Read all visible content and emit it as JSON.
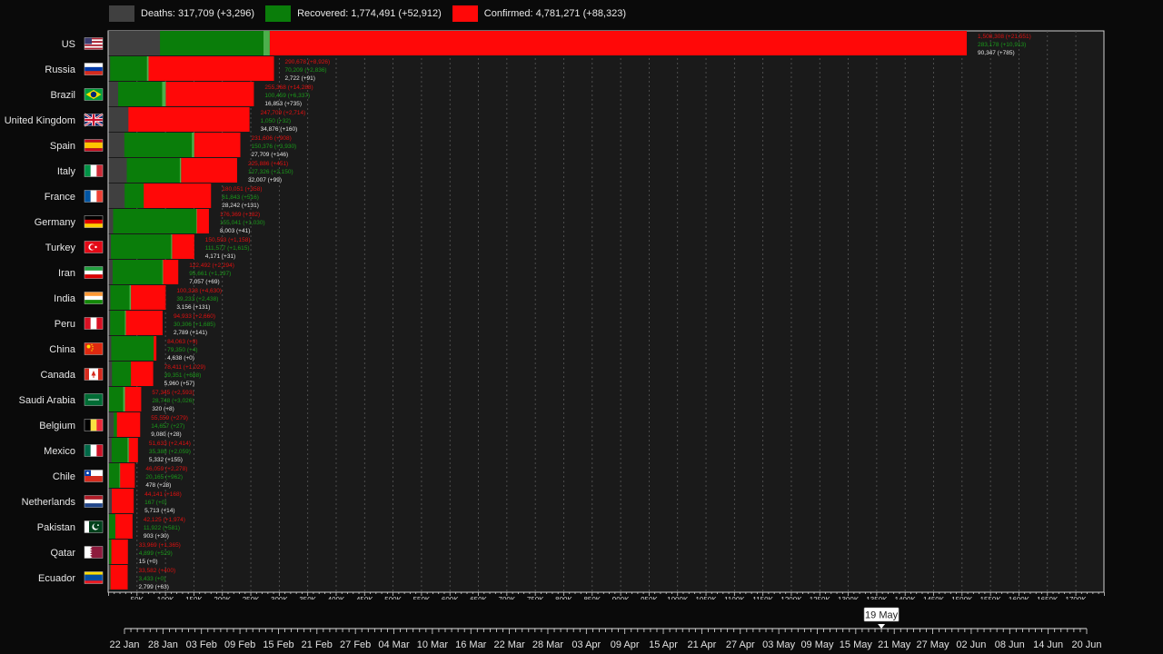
{
  "legend": {
    "deaths": "Deaths: 317,709 (+3,296)",
    "recovered": "Recovered: 1,774,491 (+52,912)",
    "confirmed": "Confirmed: 4,781,271 (+88,323)"
  },
  "colors": {
    "deaths": "#404040",
    "recovered": "#0a7d0a",
    "confirmed": "#ff0808",
    "confirmed_new": "#ff5c5c",
    "recovered_new": "#4caf4c",
    "background": "#0a0a0a",
    "plot_bg": "#1a1a1a"
  },
  "chart_data": {
    "type": "bar",
    "orientation": "horizontal",
    "stacking": "overlay",
    "grid": true,
    "xlim": [
      0,
      1750000
    ],
    "xticks": [
      "50K",
      "100K",
      "150K",
      "200K",
      "250K",
      "300K",
      "350K",
      "400K",
      "450K",
      "500K",
      "550K",
      "600K",
      "650K",
      "700K",
      "750K",
      "800K",
      "850K",
      "900K",
      "950K",
      "1000K",
      "1050K",
      "1100K",
      "1150K",
      "1200K",
      "1250K",
      "1300K",
      "1350K",
      "1400K",
      "1450K",
      "1500K",
      "1550K",
      "1600K",
      "1650K",
      "1700K"
    ],
    "categories": [
      "US",
      "Russia",
      "Brazil",
      "United Kingdom",
      "Spain",
      "Italy",
      "France",
      "Germany",
      "Turkey",
      "Iran",
      "India",
      "Peru",
      "China",
      "Canada",
      "Saudi Arabia",
      "Belgium",
      "Mexico",
      "Chile",
      "Netherlands",
      "Pakistan",
      "Qatar",
      "Ecuador"
    ],
    "series": [
      {
        "name": "Confirmed",
        "values": [
          1508308,
          290678,
          255368,
          247709,
          231606,
          225886,
          180051,
          176369,
          150593,
          122492,
          100328,
          94933,
          84063,
          78411,
          57345,
          55559,
          51633,
          46059,
          44141,
          42125,
          33969,
          33582
        ]
      },
      {
        "name": "Recovered",
        "values": [
          283178,
          70209,
          100459,
          1050,
          150376,
          127326,
          61843,
          155041,
          111577,
          95661,
          39233,
          30306,
          79350,
          39351,
          28748,
          14657,
          35388,
          20165,
          167,
          11922,
          4899,
          3433
        ]
      },
      {
        "name": "Deaths",
        "values": [
          90347,
          2722,
          16853,
          34876,
          27709,
          32007,
          28242,
          8003,
          4171,
          7057,
          3156,
          2789,
          4638,
          5960,
          320,
          9080,
          5332,
          478,
          5713,
          903,
          15,
          2799
        ]
      }
    ],
    "labels": [
      {
        "country": "US",
        "confirmed": "1,508,308 (+21,551)",
        "recovered": "283,178 (+10,913)",
        "deaths": "90,347 (+785)"
      },
      {
        "country": "Russia",
        "confirmed": "290,678 (+8,926)",
        "recovered": "70,209 (+2,836)",
        "deaths": "2,722 (+91)"
      },
      {
        "country": "Brazil",
        "confirmed": "255,368 (+14,288)",
        "recovered": "100,459 (+6,337)",
        "deaths": "16,853 (+735)"
      },
      {
        "country": "United Kingdom",
        "confirmed": "247,709 (+2,714)",
        "recovered": "1,050 (+32)",
        "deaths": "34,876 (+160)"
      },
      {
        "country": "Spain",
        "confirmed": "231,606 (+908)",
        "recovered": "150,376 (+3,930)",
        "deaths": "27,709 (+146)"
      },
      {
        "country": "Italy",
        "confirmed": "225,886 (+451)",
        "recovered": "127,326 (+2,150)",
        "deaths": "32,007 (+99)"
      },
      {
        "country": "France",
        "confirmed": "180,051 (+358)",
        "recovered": "61,843 (+516)",
        "deaths": "28,242 (+131)"
      },
      {
        "country": "Germany",
        "confirmed": "176,369 (+182)",
        "recovered": "155,041 (+1,030)",
        "deaths": "8,003 (+41)"
      },
      {
        "country": "Turkey",
        "confirmed": "150,593 (+1,158)",
        "recovered": "111,577 (+1,615)",
        "deaths": "4,171 (+31)"
      },
      {
        "country": "Iran",
        "confirmed": "122,492 (+2,294)",
        "recovered": "95,661 (+1,197)",
        "deaths": "7,057 (+69)"
      },
      {
        "country": "India",
        "confirmed": "100,328 (+4,630)",
        "recovered": "39,233 (+2,438)",
        "deaths": "3,156 (+131)"
      },
      {
        "country": "Peru",
        "confirmed": "94,933 (+2,660)",
        "recovered": "30,306 (+1,685)",
        "deaths": "2,789 (+141)"
      },
      {
        "country": "China",
        "confirmed": "84,063 (+9)",
        "recovered": "79,350 (+4)",
        "deaths": "4,638 (+0)"
      },
      {
        "country": "Canada",
        "confirmed": "78,411 (+1,029)",
        "recovered": "39,351 (+688)",
        "deaths": "5,960 (+57)"
      },
      {
        "country": "Saudi Arabia",
        "confirmed": "57,345 (+2,593)",
        "recovered": "28,748 (+3,026)",
        "deaths": "320 (+8)"
      },
      {
        "country": "Belgium",
        "confirmed": "55,559 (+279)",
        "recovered": "14,657 (+27)",
        "deaths": "9,080 (+28)"
      },
      {
        "country": "Mexico",
        "confirmed": "51,633 (+2,414)",
        "recovered": "35,388 (+2,059)",
        "deaths": "5,332 (+155)"
      },
      {
        "country": "Chile",
        "confirmed": "46,059 (+2,278)",
        "recovered": "20,165 (+962)",
        "deaths": "478 (+28)"
      },
      {
        "country": "Netherlands",
        "confirmed": "44,141 (+168)",
        "recovered": "167 (+0)",
        "deaths": "5,713 (+14)"
      },
      {
        "country": "Pakistan",
        "confirmed": "42,125 (+1,974)",
        "recovered": "11,922 (+581)",
        "deaths": "903 (+30)"
      },
      {
        "country": "Qatar",
        "confirmed": "33,969 (+1,365)",
        "recovered": "4,899 (+529)",
        "deaths": "15 (+0)"
      },
      {
        "country": "Ecuador",
        "confirmed": "33,582 (+400)",
        "recovered": "3,433 (+0)",
        "deaths": "2,799 (+63)"
      }
    ]
  },
  "timeline": {
    "dates": [
      "22 Jan",
      "28 Jan",
      "03 Feb",
      "09 Feb",
      "15 Feb",
      "21 Feb",
      "27 Feb",
      "04 Mar",
      "10 Mar",
      "16 Mar",
      "22 Mar",
      "28 Mar",
      "03 Apr",
      "09 Apr",
      "15 Apr",
      "21 Apr",
      "27 Apr",
      "03 May",
      "09 May",
      "15 May",
      "21 May",
      "27 May",
      "02 Jun",
      "08 Jun",
      "14 Jun",
      "20 Jun"
    ],
    "current": "19 May"
  }
}
